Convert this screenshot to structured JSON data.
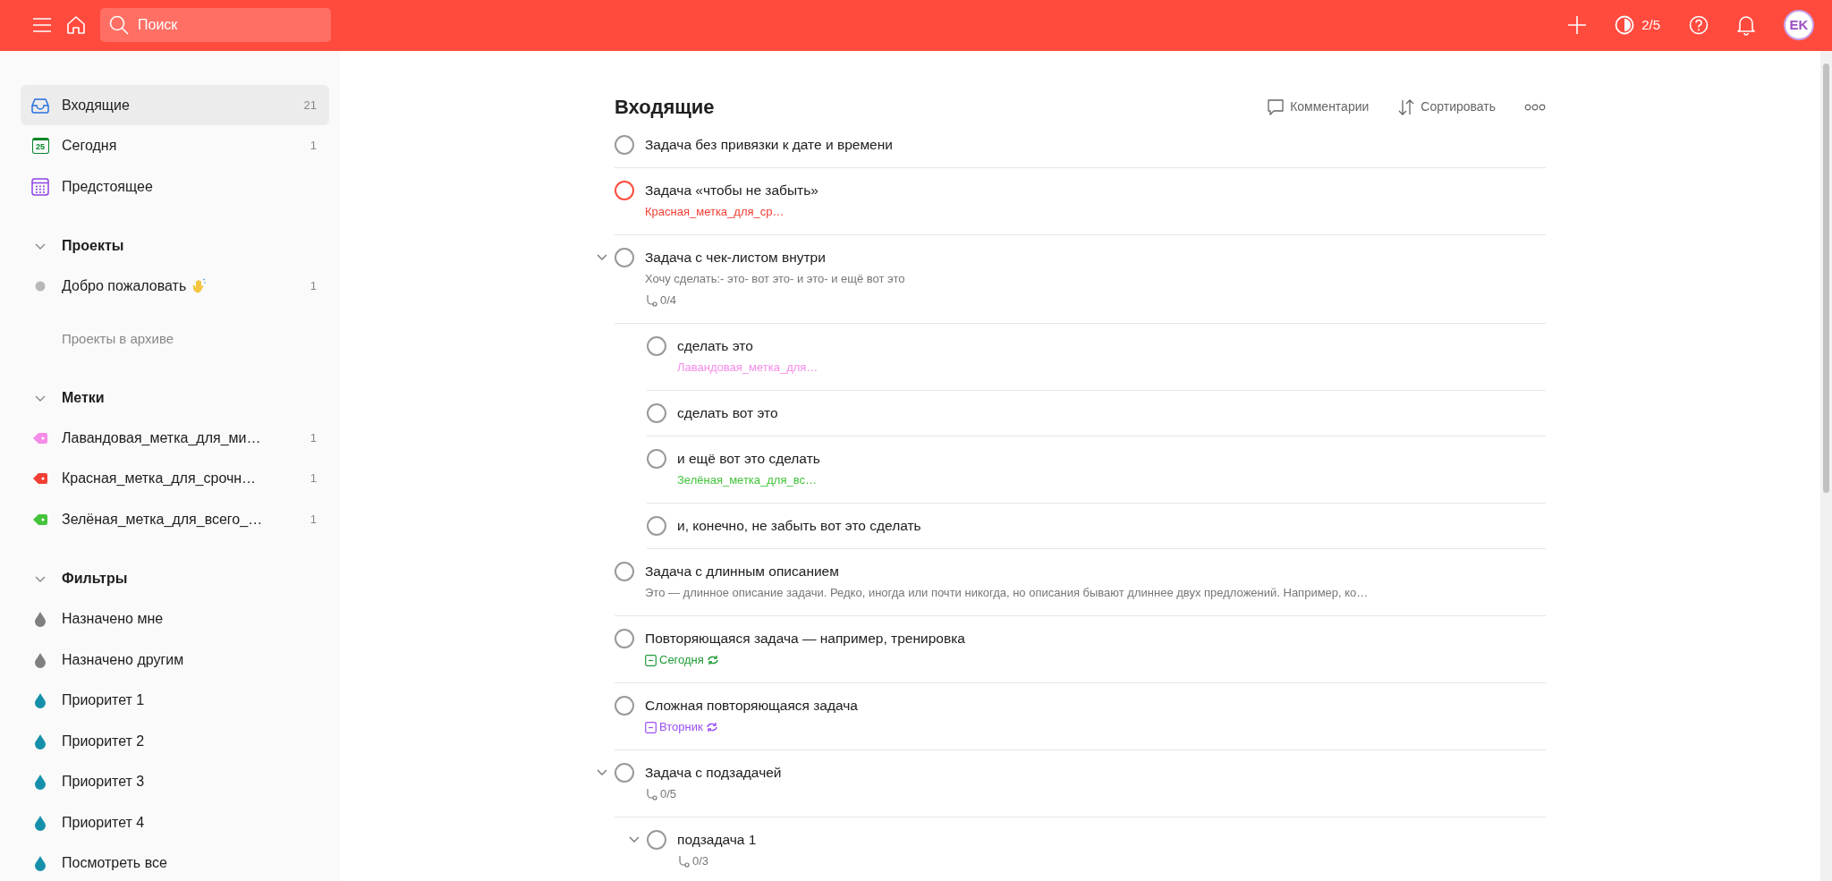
{
  "topbar": {
    "search": {
      "placeholder": "Поиск"
    },
    "karma": "2/5",
    "avatar": "EK"
  },
  "sidebar": {
    "nav": [
      {
        "kind": "inbox",
        "label": "Входящие",
        "count": "21",
        "selected": true
      },
      {
        "kind": "today",
        "label": "Сегодня",
        "count": "1",
        "icon_text": "25",
        "selected": false
      },
      {
        "kind": "upcoming",
        "label": "Предстоящее",
        "selected": false
      }
    ],
    "projects": {
      "title": "Проекты",
      "expanded": true,
      "items": [
        {
          "label": "Добро пожаловать",
          "count": "1",
          "color": "#b8b8b8"
        }
      ],
      "archive": "Проекты в архиве"
    },
    "labels": {
      "title": "Метки",
      "expanded": true,
      "items": [
        {
          "label": "Лавандовая_метка_для_ми…",
          "count": "1",
          "color": "#f58ce8"
        },
        {
          "label": "Красная_метка_для_срочн…",
          "count": "1",
          "color": "#f23f33"
        },
        {
          "label": "Зелёная_метка_для_всего_…",
          "count": "1",
          "color": "#43c43a"
        }
      ]
    },
    "filters": {
      "title": "Фильтры",
      "expanded": true,
      "items": [
        {
          "label": "Назначено мне",
          "color": "#808080"
        },
        {
          "label": "Назначено другим",
          "color": "#808080"
        },
        {
          "label": "Приоритет 1",
          "color": "#1690aa"
        },
        {
          "label": "Приоритет 2",
          "color": "#1690aa"
        },
        {
          "label": "Приоритет 3",
          "color": "#1690aa"
        },
        {
          "label": "Приоритет 4",
          "color": "#1690aa"
        },
        {
          "label": "Посмотреть все",
          "color": "#1690aa"
        }
      ]
    }
  },
  "main": {
    "title": "Входящие",
    "actions": [
      {
        "kind": "comments",
        "label": "Комментарии"
      },
      {
        "kind": "sort",
        "label": "Сортировать"
      },
      {
        "kind": "more"
      }
    ],
    "tasks": [
      {
        "title": "Задача без привязки к дате и времени",
        "color": "#999999"
      },
      {
        "title": "Задача «чтобы не забыть»",
        "color": "#ff4d3d",
        "label": {
          "text": "Красная_метка_для_ср…",
          "color": "#f23f33"
        }
      },
      {
        "title": "Задача с чек-листом внутри",
        "color": "#999999",
        "expanded": true,
        "description": "Хочу сделать:- это- вот это- и это- и ещё вот это",
        "subtasks": "0/4",
        "children": [
          {
            "title": "сделать это",
            "color": "#999999",
            "label": {
              "text": "Лавандовая_метка_для…",
              "color": "#f58ce8"
            }
          },
          {
            "title": "сделать вот это",
            "color": "#999999"
          },
          {
            "title": "и ещё вот это сделать",
            "color": "#999999",
            "label": {
              "text": "Зелёная_метка_для_вс…",
              "color": "#43c43a"
            }
          },
          {
            "title": "и, конечно, не забыть вот это сделать",
            "color": "#999999"
          }
        ]
      },
      {
        "title": "Задача с длинным описанием",
        "color": "#999999",
        "description": "Это — длинное описание задачи. Редко, иногда или почти никогда, но описания бывают длиннее двух предложений. Например, ко…"
      },
      {
        "title": "Повторяющаяся задача — например, тренировка",
        "color": "#999999",
        "due": {
          "text": "Сегодня",
          "color": "#1e9b36",
          "recurring": true
        }
      },
      {
        "title": "Сложная повторяющаяся задача",
        "color": "#999999",
        "due": {
          "text": "Вторник",
          "color": "#9b4ff2",
          "recurring": true
        }
      },
      {
        "title": "Задача с подзадачей",
        "color": "#999999",
        "expanded": true,
        "subtasks": "0/5",
        "children": [
          {
            "title": "подзадача 1",
            "color": "#999999",
            "expanded": true,
            "subtasks": "0/3"
          }
        ]
      }
    ]
  }
}
